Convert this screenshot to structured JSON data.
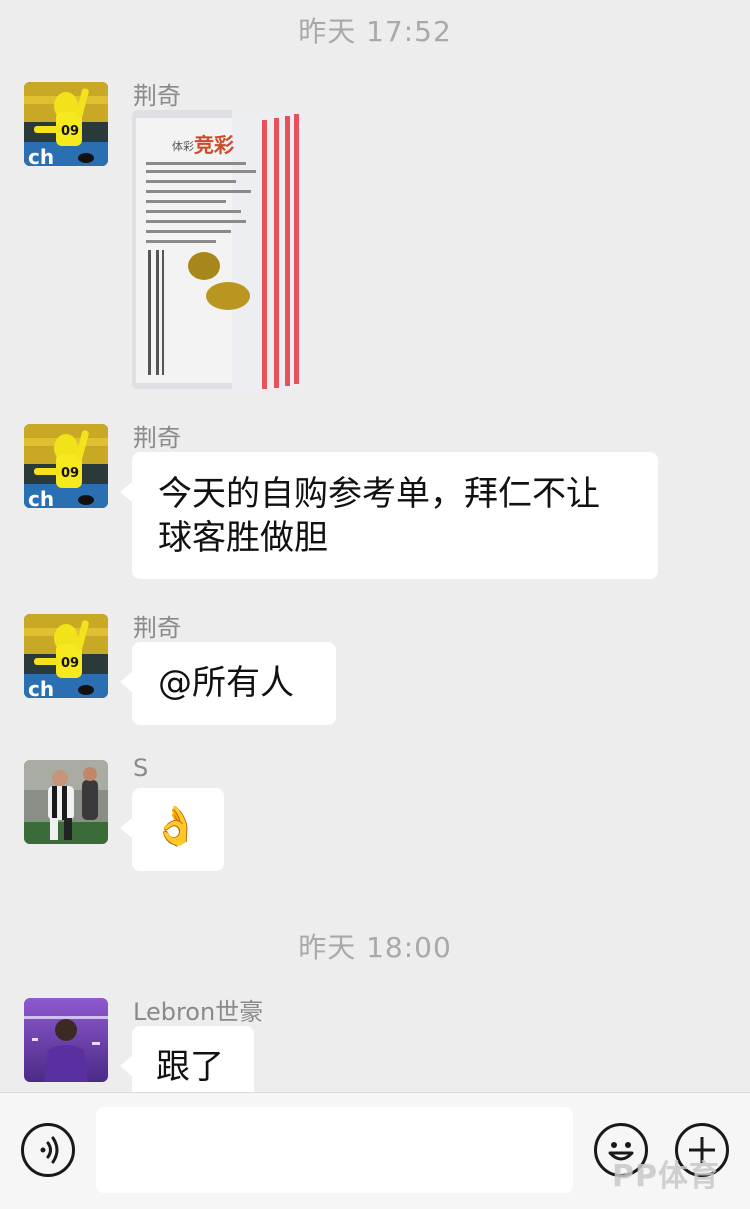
{
  "chat": {
    "timestamps": [
      "昨天 17:52",
      "昨天 18:00"
    ],
    "messages": [
      {
        "sender": "荆奇",
        "type": "image",
        "image_text": {
          "brand": "竞彩",
          "prefix": "体彩"
        }
      },
      {
        "sender": "荆奇",
        "type": "text",
        "lines": [
          "今天的自购参考单，拜仁不让",
          "球客胜做胆"
        ]
      },
      {
        "sender": "荆奇",
        "type": "text",
        "lines": [
          "@所有人"
        ]
      },
      {
        "sender": "S",
        "type": "emoji",
        "emoji": "👌"
      },
      {
        "sender": "Lebron世豪",
        "type": "text",
        "lines": [
          "跟了"
        ]
      }
    ],
    "avatars": {
      "jingqi": {
        "jersey_number": "09",
        "banner_text": "ch"
      },
      "s": {
        "icon": "soccer-player-avatar"
      },
      "lebron": {
        "icon": "basketball-player-avatar"
      }
    }
  },
  "input_bar": {
    "voice_icon": "voice-icon",
    "emoji_icon": "emoji-icon",
    "plus_icon": "plus-icon",
    "input_value": ""
  },
  "watermark": {
    "text": "PP体育"
  },
  "colors": {
    "background": "#ededed",
    "bubble": "#ffffff",
    "timestamp": "#a9a9a9",
    "sender": "#8a8a8a",
    "ticket_red": "#e8505b"
  }
}
